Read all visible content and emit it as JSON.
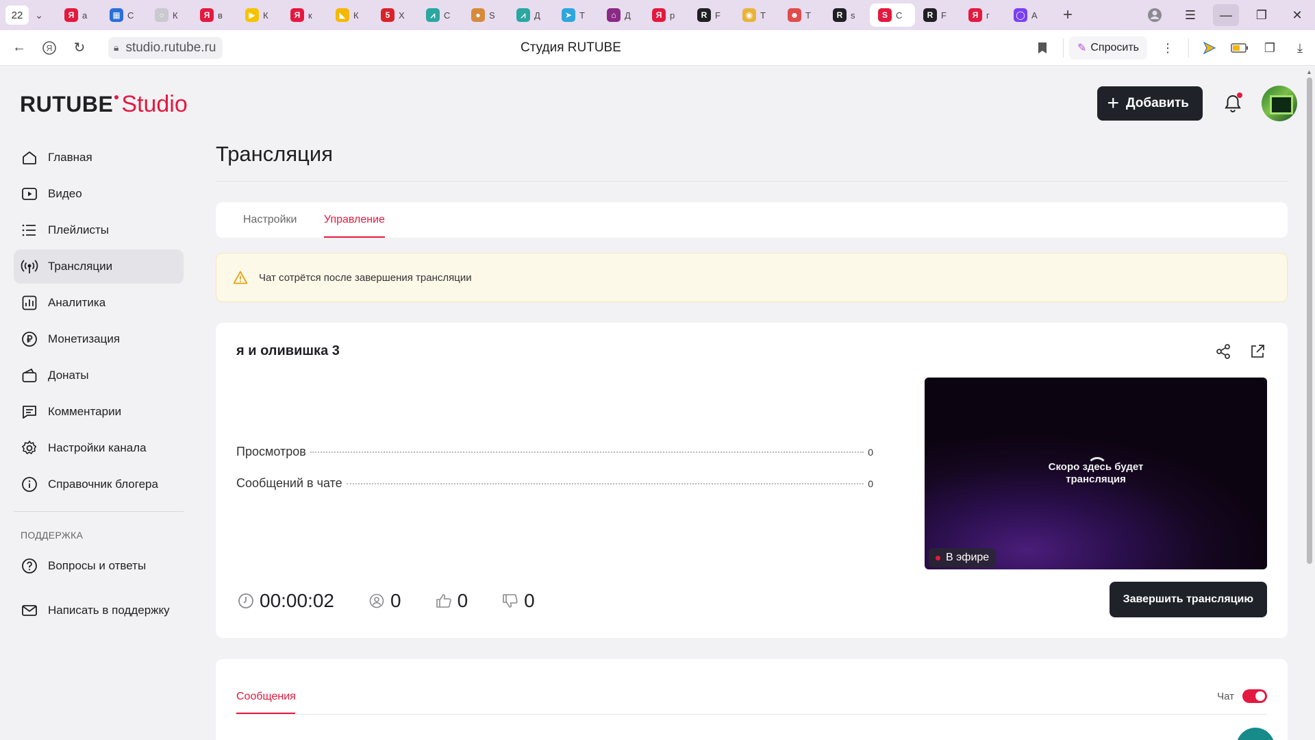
{
  "browser": {
    "tab_count": "22",
    "tabs": [
      {
        "icon": "yandex-icon",
        "color": "#e4193f",
        "glyph": "Я",
        "title": "а"
      },
      {
        "icon": "grid-icon",
        "color": "#2a6fd8",
        "glyph": "▦",
        "title": "С"
      },
      {
        "icon": "cloud-icon",
        "color": "#c9c9cf",
        "glyph": "○",
        "title": "К"
      },
      {
        "icon": "yandex-icon",
        "color": "#e4193f",
        "glyph": "Я",
        "title": "в"
      },
      {
        "icon": "play-icon",
        "color": "#f5c400",
        "glyph": "▶",
        "title": "К"
      },
      {
        "icon": "yandex-icon",
        "color": "#e4193f",
        "glyph": "Я",
        "title": "к"
      },
      {
        "icon": "image-icon",
        "color": "#f5b800",
        "glyph": "◣",
        "title": "К"
      },
      {
        "icon": "five-icon",
        "color": "#d8232a",
        "glyph": "5",
        "title": "Х"
      },
      {
        "icon": "chart-icon",
        "color": "#2aa7a0",
        "glyph": "⩘",
        "title": "С"
      },
      {
        "icon": "cookie-icon",
        "color": "#d88a3b",
        "glyph": "●",
        "title": "S"
      },
      {
        "icon": "chart-icon",
        "color": "#2aa7a0",
        "glyph": "⩘",
        "title": "Д"
      },
      {
        "icon": "telegram-icon",
        "color": "#2ea6de",
        "glyph": "➤",
        "title": "Т"
      },
      {
        "icon": "house-icon",
        "color": "#8b2a86",
        "glyph": "⌂",
        "title": "Д"
      },
      {
        "icon": "yandex-icon",
        "color": "#e4193f",
        "glyph": "Я",
        "title": "р"
      },
      {
        "icon": "r-logo-icon",
        "color": "#1f1f24",
        "glyph": "R",
        "title": "F"
      },
      {
        "icon": "eye-icon",
        "color": "#e8b33a",
        "glyph": "◉",
        "title": "Т"
      },
      {
        "icon": "cat-icon",
        "color": "#e04c4c",
        "glyph": "☻",
        "title": "Т"
      },
      {
        "icon": "r-logo-icon",
        "color": "#1f1f24",
        "glyph": "R",
        "title": "s"
      },
      {
        "icon": "studio-icon",
        "color": "#e4193f",
        "glyph": "S",
        "title": "С",
        "active": true
      },
      {
        "icon": "rutube-icon",
        "color": "#1f1f24",
        "glyph": "R",
        "title": "F"
      },
      {
        "icon": "yandex-icon",
        "color": "#e4193f",
        "glyph": "Я",
        "title": "г"
      },
      {
        "icon": "alice-icon",
        "color": "#7a3ff2",
        "glyph": "◯",
        "title": "А"
      }
    ],
    "url": "studio.rutube.ru",
    "page_title": "Студия RUTUBE",
    "ask_label": "Спросить"
  },
  "app": {
    "logo_main": "RUTUBE",
    "logo_studio": "Studio",
    "add_label": "Добавить",
    "brand_color": "#e4193f"
  },
  "sidebar": {
    "items": [
      {
        "name": "home",
        "label": "Главная"
      },
      {
        "name": "video",
        "label": "Видео"
      },
      {
        "name": "playlists",
        "label": "Плейлисты"
      },
      {
        "name": "broadcasts",
        "label": "Трансляции",
        "active": true
      },
      {
        "name": "analytics",
        "label": "Аналитика"
      },
      {
        "name": "monetization",
        "label": "Монетизация"
      },
      {
        "name": "donations",
        "label": "Донаты"
      },
      {
        "name": "comments",
        "label": "Комментарии"
      },
      {
        "name": "channel-settings",
        "label": "Настройки канала"
      },
      {
        "name": "blogger-guide",
        "label": "Справочник блогера"
      }
    ],
    "support_title": "ПОДДЕРЖКА",
    "support_items": [
      {
        "name": "faq",
        "label": "Вопросы и ответы"
      },
      {
        "name": "write-support",
        "label": "Написать в поддержку"
      }
    ]
  },
  "main": {
    "title": "Трансляция",
    "tabs": [
      {
        "label": "Настройки"
      },
      {
        "label": "Управление",
        "active": true
      }
    ],
    "alert_text": "Чат сотрётся после завершения трансляции",
    "stream": {
      "name": "я и оливишка 3",
      "stats": [
        {
          "label": "Просмотров",
          "value": "0"
        },
        {
          "label": "Сообщений в чате",
          "value": "0"
        }
      ],
      "player_message_line1": "Скоро здесь будет",
      "player_message_line2": "трансляция",
      "live_label": "В эфире",
      "duration": "00:00:02",
      "viewers": "0",
      "likes": "0",
      "dislikes": "0",
      "end_label": "Завершить трансляцию"
    },
    "chat": {
      "tab_label": "Сообщения",
      "toggle_label": "Чат",
      "toggle_on": true
    }
  }
}
